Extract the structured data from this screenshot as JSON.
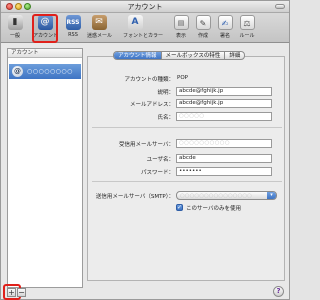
{
  "window": {
    "title": "アカウント"
  },
  "toolbar": {
    "items": [
      {
        "label": "一般",
        "icon": "general-switch-icon"
      },
      {
        "label": "アカウント",
        "icon": "at-sign-icon"
      },
      {
        "label": "RSS",
        "icon": "rss-icon"
      },
      {
        "label": "迷惑メール",
        "icon": "junk-mail-icon"
      },
      {
        "label": "フォントとカラー",
        "icon": "fonts-colors-icon"
      },
      {
        "label": "表示",
        "icon": "view-icon"
      },
      {
        "label": "作成",
        "icon": "compose-icon"
      },
      {
        "label": "署名",
        "icon": "signature-icon"
      },
      {
        "label": "ルール",
        "icon": "rules-icon"
      }
    ],
    "selected": "アカウント",
    "highlight_color": "#e0201a"
  },
  "accounts": {
    "header": "アカウント",
    "selected_name": "○○○○○○○○",
    "avatar_glyph": "@",
    "add_label": "+",
    "remove_label": "−"
  },
  "tabs": [
    "アカウント情報",
    "メールボックスの特性",
    "詳細"
  ],
  "active_tab": "アカウント情報",
  "form": {
    "account_type": {
      "label": "アカウントの種類：",
      "value": "POP"
    },
    "description": {
      "label": "説明：",
      "value": "abcde@fghijk.jp"
    },
    "email": {
      "label": "メールアドレス：",
      "value": "abcde@fghijk.jp"
    },
    "full_name": {
      "label": "氏名：",
      "value": "○○○○○"
    },
    "incoming_server": {
      "label": "受信用メールサーバ：",
      "value": "○○○○○○○○○○"
    },
    "username": {
      "label": "ユーザ名：",
      "value": "abcde"
    },
    "password": {
      "label": "パスワード：",
      "value": "•••••••"
    },
    "outgoing_smtp": {
      "label": "送信用メールサーバ（SMTP）：",
      "value": "○○○○○○○○○○○○○○○"
    },
    "only_this_server": {
      "label": "このサーバのみを使用",
      "checked": true
    }
  },
  "help": {
    "label": "?"
  },
  "colors": {
    "accent": "#3e74c4",
    "highlight": "#e0201a"
  }
}
